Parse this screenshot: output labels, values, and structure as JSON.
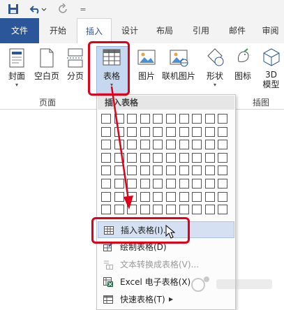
{
  "quick_access": {
    "separator": "|",
    "more": "="
  },
  "tabs": [
    {
      "label": "文件"
    },
    {
      "label": "开始"
    },
    {
      "label": "插入"
    },
    {
      "label": "设计"
    },
    {
      "label": "布局"
    },
    {
      "label": "引用"
    },
    {
      "label": "邮件"
    },
    {
      "label": "审阅"
    }
  ],
  "ribbon": {
    "buttons": [
      {
        "label": "封面",
        "has_dropdown": true
      },
      {
        "label": "空白页"
      },
      {
        "label": "分页"
      },
      {
        "label": "表格",
        "has_dropdown": true
      },
      {
        "label": "图片"
      },
      {
        "label": "联机图片"
      },
      {
        "label": "形状",
        "has_dropdown": true
      },
      {
        "label": "图标"
      },
      {
        "label": "3D\n模型",
        "label_line1": "3D",
        "label_line2": "模型"
      }
    ],
    "groups": [
      {
        "label": "页面"
      },
      {
        "label": "插图"
      }
    ]
  },
  "dropdown": {
    "header": "插入表格",
    "grid": {
      "cols": 10,
      "rows": 8
    },
    "items": [
      {
        "label": "插入表格(I)...",
        "highlighted": true,
        "disabled": false
      },
      {
        "label": "绘制表格(D)",
        "highlighted": false,
        "disabled": false
      },
      {
        "label": "文本转换成表格(V)...",
        "highlighted": false,
        "disabled": true
      },
      {
        "label": "Excel 电子表格(X)",
        "highlighted": false,
        "disabled": false
      },
      {
        "label": "快速表格(T)",
        "highlighted": false,
        "disabled": false,
        "submenu": true
      }
    ]
  },
  "colors": {
    "accent": "#2b579a",
    "highlight_annotation": "#e0001a",
    "selected_button": "#c5d8ef"
  }
}
